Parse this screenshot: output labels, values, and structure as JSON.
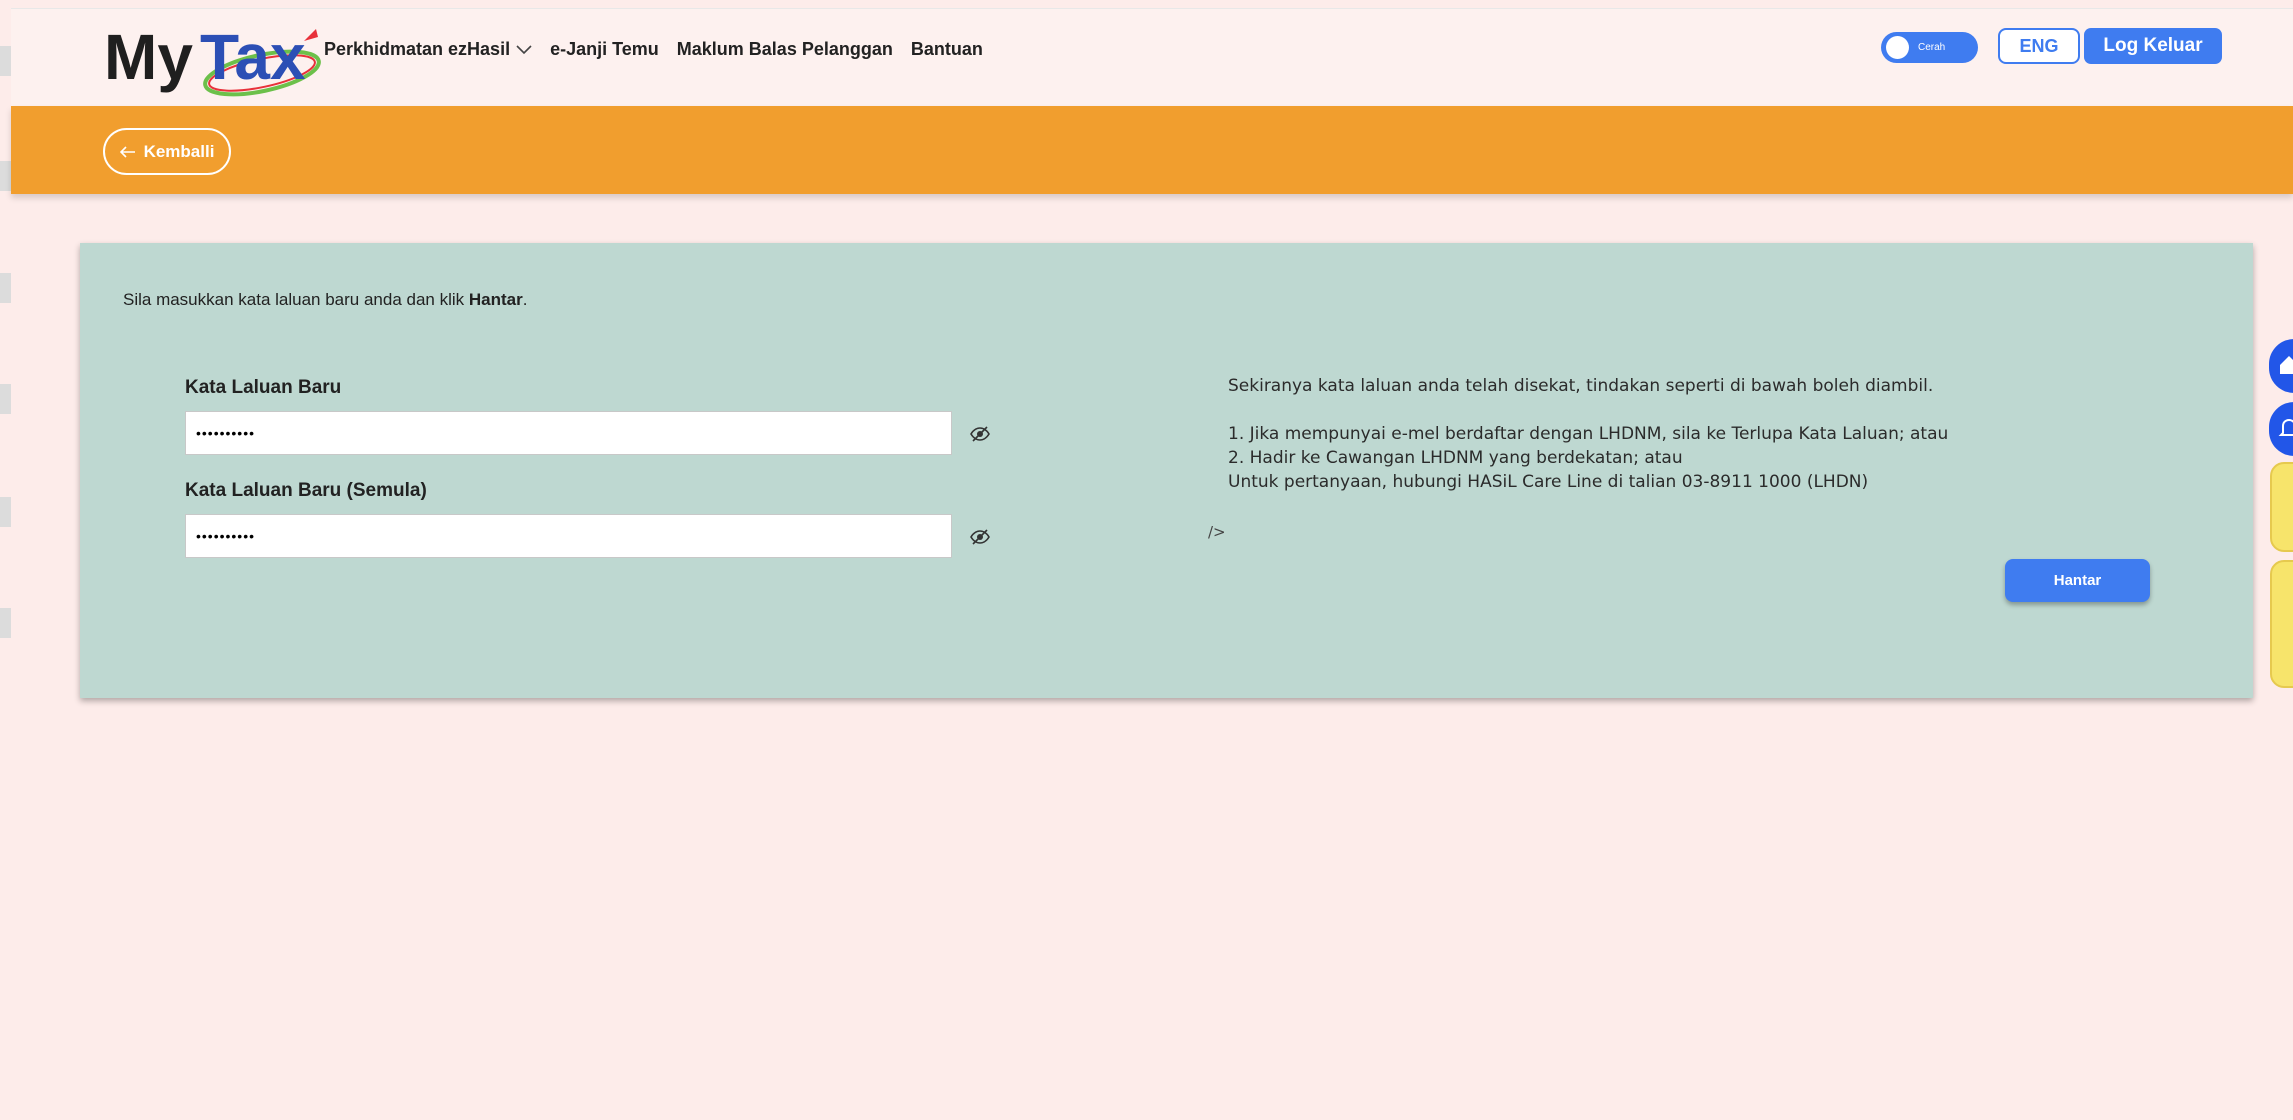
{
  "header": {
    "logo_text": "MyTax",
    "nav": [
      {
        "label": "Perkhidmatan ezHasil",
        "has_dropdown": true
      },
      {
        "label": "e-Janji Temu",
        "has_dropdown": false
      },
      {
        "label": "Maklum Balas Pelanggan",
        "has_dropdown": false
      },
      {
        "label": "Bantuan",
        "has_dropdown": false
      }
    ],
    "theme_toggle_label": "Cerah",
    "language_button": "ENG",
    "logout_button": "Log Keluar"
  },
  "banner": {
    "back_button": "Kemballi"
  },
  "form": {
    "instruction_prefix": "Sila masukkan kata laluan baru anda dan klik ",
    "instruction_bold": "Hantar",
    "instruction_suffix": ".",
    "new_password_label": "Kata Laluan Baru",
    "new_password_value": "••••••••••",
    "confirm_password_label": "Kata Laluan Baru (Semula)",
    "confirm_password_value": "••••••••••",
    "submit_button": "Hantar"
  },
  "info": {
    "line1": "Sekiranya kata laluan anda telah disekat, tindakan seperti di bawah boleh diambil.",
    "line2": "1. Jika mempunyai e-mel berdaftar dengan LHDNM, sila ke Terlupa Kata Laluan; atau",
    "line3": "2. Hadir ke Cawangan LHDNM yang berdekatan; atau",
    "line4": "Untuk pertanyaan, hubungi HASiL Care Line di talian 03-8911 1000 (LHDN)",
    "stray_text": "/>"
  },
  "colors": {
    "accent_blue": "#3f7cf0",
    "banner_orange": "#f19e2e",
    "card_bg": "#bed8d1",
    "page_bg": "#fdecea"
  },
  "icons": {
    "dropdown": "chevron-down-icon",
    "back": "arrow-left-icon",
    "eye": "eye-slash-icon",
    "home": "home-icon",
    "bell": "bell-icon"
  }
}
